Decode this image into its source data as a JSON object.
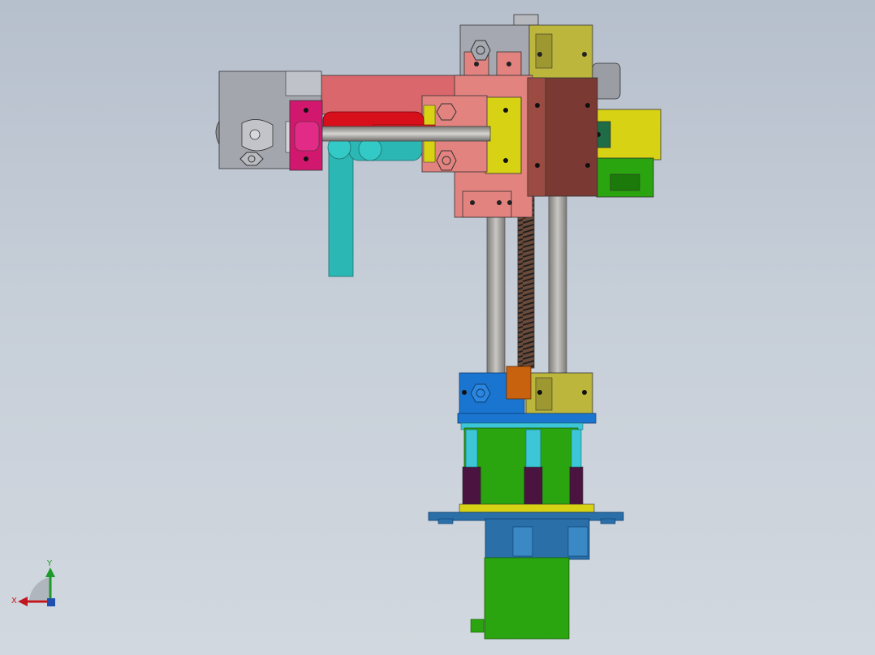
{
  "triad": {
    "x_label": "X",
    "y_label": "Y",
    "x_color": "#c0161d",
    "y_color": "#1d9a2a"
  },
  "model": {
    "colors": {
      "arm_pink": "#d9676b",
      "arm_salmon": "#e2837f",
      "magenta": "#d2186e",
      "red": "#d70f1a",
      "teal": "#2bb7b4",
      "gray_block": "#a3a6ad",
      "yellow": "#d7d214",
      "olive": "#bdb63c",
      "brown": "#7a3a33",
      "rod_gray": "#a9a7a3",
      "spring_dark": "#3a3a3a",
      "blue": "#1a75d0",
      "cyan": "#3cc6d8",
      "green": "#2aa40f",
      "purple": "#4b1340",
      "base_plate": "#2a6fa8",
      "orange": "#c8620f"
    },
    "icons": [
      "hex-nut-icon",
      "hex-nut-icon",
      "hex-nut-icon",
      "hex-nut-icon",
      "hex-nut-icon",
      "hex-nut-icon"
    ]
  }
}
